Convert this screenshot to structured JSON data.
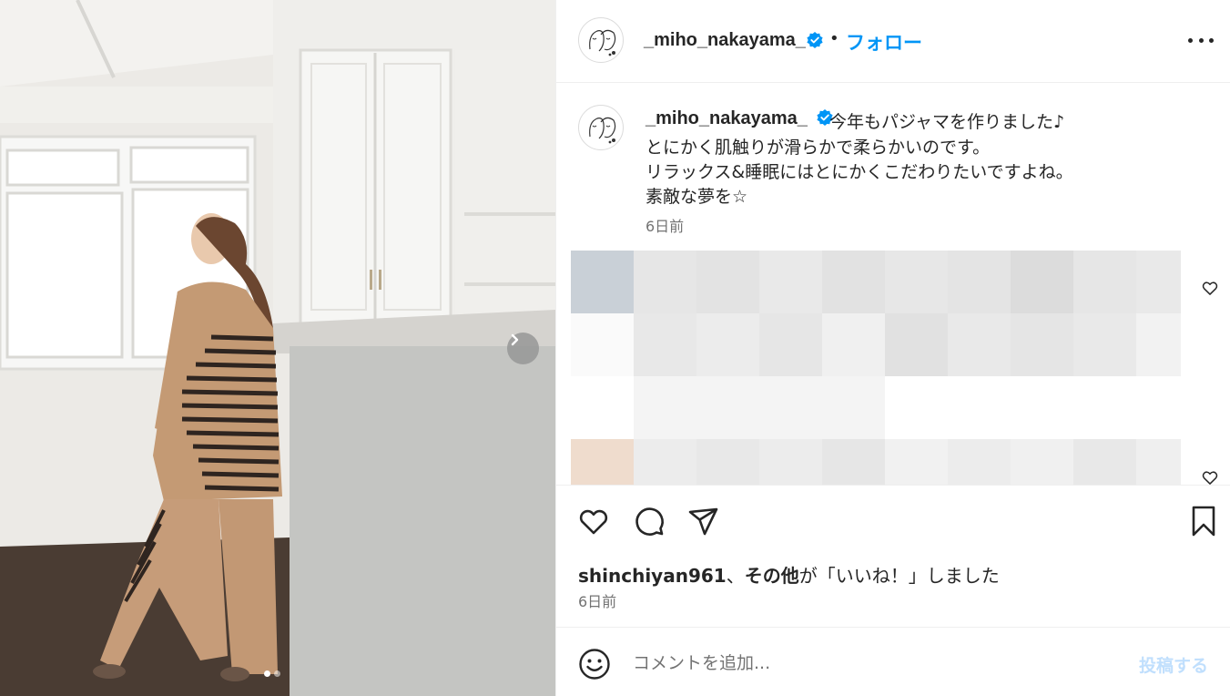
{
  "post": {
    "username": "_miho_nakayama_",
    "follow_label": "フォロー",
    "bullet": "•",
    "caption_lines": [
      "今年もパジャマを作りました♪",
      "とにかく肌触りが滑らかで柔らかいのです。",
      "リラックス&睡眠にはとにかくこだわりたいですよね。",
      "素敵な夢を☆"
    ],
    "caption_time": "6日前",
    "likes_user": "shinchiyan961",
    "likes_sep": "、",
    "likes_others": "その他",
    "likes_suffix": "が「いいね！」しました",
    "post_time": "6日前"
  },
  "comment": {
    "placeholder": "コメントを追加...",
    "post_label": "投稿する"
  },
  "carousel": {
    "current": 1,
    "total": 2
  },
  "colors": {
    "accent": "#0095f6",
    "verified": "#0095f6",
    "post_disabled": "#c0dffd",
    "text": "#262626",
    "secondary": "#737373"
  },
  "icons": {
    "more": "more-horizontal-icon",
    "next": "chevron-right-icon",
    "like": "heart-icon",
    "comment": "comment-bubble-icon",
    "share": "paper-plane-icon",
    "save": "bookmark-icon",
    "emoji": "smiley-icon",
    "verified": "verified-badge-icon"
  }
}
